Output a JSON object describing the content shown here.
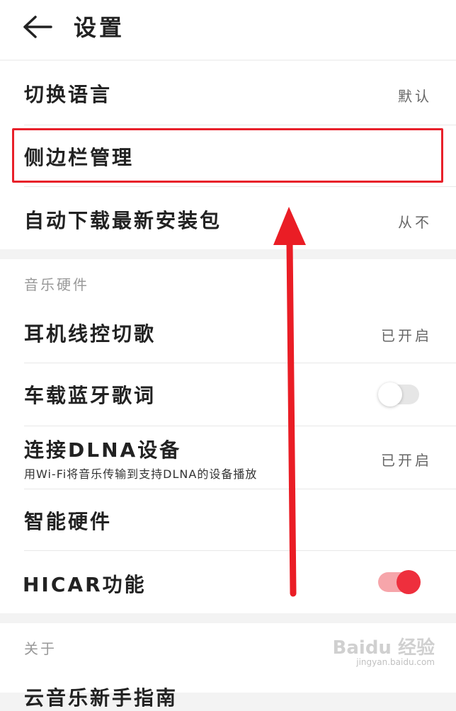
{
  "header": {
    "title": "设置"
  },
  "general": {
    "items": [
      {
        "label": "切换语言",
        "value": "默认"
      },
      {
        "label": "侧边栏管理"
      },
      {
        "label": "自动下载最新安装包",
        "value": "从不"
      }
    ]
  },
  "music_hardware": {
    "title": "音乐硬件",
    "items": [
      {
        "label": "耳机线控切歌",
        "value": "已开启"
      },
      {
        "label": "车载蓝牙歌词",
        "toggle": false
      },
      {
        "label": "连接DLNA设备",
        "subtitle": "用Wi-Fi将音乐传输到支持DLNA的设备播放",
        "value": "已开启"
      },
      {
        "label": "智能硬件"
      },
      {
        "label": "HICAR功能",
        "toggle": true
      }
    ]
  },
  "about": {
    "title": "关于",
    "items": [
      {
        "label": "云音乐新手指南"
      }
    ]
  },
  "watermark": {
    "main": "Baidu 经验",
    "sub": "jingyan.baidu.com"
  },
  "colors": {
    "accent": "#ee2f3d",
    "highlight_border": "#e8202a"
  }
}
